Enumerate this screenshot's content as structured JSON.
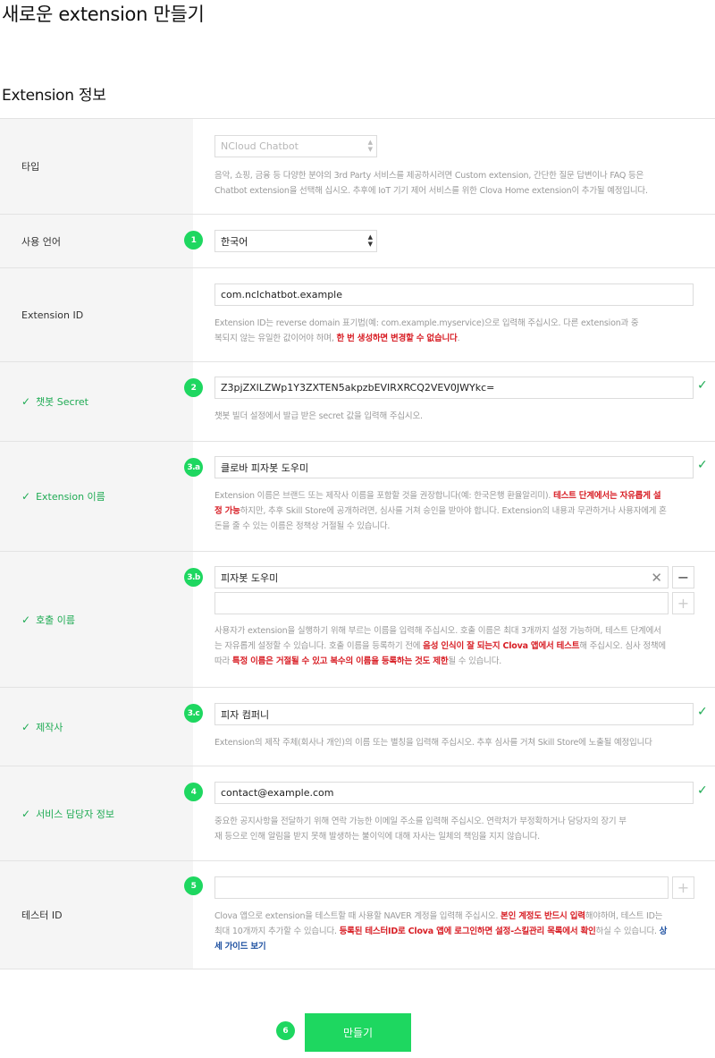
{
  "page": {
    "title": "새로운 extension 만들기",
    "section_title": "Extension 정보"
  },
  "colors": {
    "accent": "#1ed760",
    "valid": "#1fab54",
    "warning": "#d81f26",
    "link": "#1c4fa0"
  },
  "icons": {
    "check": "check-icon",
    "clear": "close-icon",
    "remove": "minus-icon",
    "add": "plus-icon",
    "select": "select-arrows-icon"
  },
  "rows": {
    "type": {
      "label": "타입",
      "value": "NCloud Chatbot",
      "help1": "음악, 쇼핑, 금융 등 다양한 분야의 3rd Party 서비스를 제공하시려면 Custom extension, 간단한 질문 답변이나 FAQ 등은",
      "help2": "Chatbot extension을 선택해 십시오. 추후에 IoT 기기 제어 서비스를 위한 Clova Home extension이 추가될 예정입니다."
    },
    "language": {
      "label": "사용 언어",
      "badge": "1",
      "value": "한국어"
    },
    "extension_id": {
      "label": "Extension ID",
      "value": "com.nclchatbot.example",
      "help1": "Extension ID는 reverse domain 표기법(예: com.example.myservice)으로 입력해 주십시오. 다른 extension과 중",
      "help2a": "복되지 않는 유일한 값이어야 하며, ",
      "help2b": "한 번 생성하면 변경할 수 없습니다",
      "help2c": "."
    },
    "secret": {
      "label": "챗봇 Secret",
      "badge": "2",
      "value": "Z3pjZXlLZWp1Y3ZXTEN5akpzbEVIRXRCQ2VEV0JWYkc=",
      "help": "챗봇 빌더 설정에서 발급 받은 secret 값을 입력해 주십시오."
    },
    "ext_name": {
      "label": "Extension 이름",
      "badge": "3.a",
      "value": "클로바 피자봇 도우미",
      "help1a": "Extension 이름은 브랜드 또는 제작사 이름을 포함할 것을 권장합니다(예: 한국은행 환율알리미). ",
      "help1b": "테스트 단계에서는 자유롭게 설",
      "help2a": "정 가능",
      "help2b": "하지만, 추후 Skill Store에 공개하려면, 심사를 거쳐 승인을 받아야 합니다. Extension의 내용과 무관하거나 사용자에게 혼",
      "help3": "돈을 줄 수 있는 이름은 정책상 거절될 수 있습니다."
    },
    "call_name": {
      "label": "호출 이름",
      "badge": "3.b",
      "value": "피자봇 도우미",
      "second_value": "",
      "remove_label": "−",
      "add_label": "+",
      "help1": "사용자가 extension을 실행하기 위해 부르는 이름을 입력해 주십시오. 호출 이름은 최대 3개까지 설정 가능하며, 테스트 단계에서",
      "help2a": "는 자유롭게 설정할 수 있습니다. 호출 이름을 등록하기 전에 ",
      "help2b": "음성 인식이 잘 되는지 Clova 앱에서 테스트",
      "help2c": "해 주십시오. 심사 정책에",
      "help3a": "따라 ",
      "help3b": "특정 이름은 거절될 수 있고 복수의 이름을 등록하는 것도 제한",
      "help3c": "될 수 있습니다."
    },
    "maker": {
      "label": "제작사",
      "badge": "3.c",
      "value": "피자 컴퍼니",
      "help": "Extension의 제작 주체(회사나 개인)의 이름 또는 별칭을 입력해 주십시오. 추후 심사를 거쳐 Skill Store에 노출될 예정입니다"
    },
    "contact": {
      "label": "서비스 담당자 정보",
      "badge": "4",
      "value": "contact@example.com",
      "help1": "중요한 공지사항을 전달하기 위해 연락 가능한 이메일 주소를 입력해 주십시오. 연락처가 부정확하거나 담당자의 장기 부",
      "help2": "재 등으로 인해 알림을 받지 못해 발생하는 불이익에 대해 자사는 일체의 책임을 지지 않습니다."
    },
    "tester": {
      "label": "테스터 ID",
      "badge": "5",
      "value": "",
      "add_label": "+",
      "help1a": "Clova 앱으로 extension을 테스트할 때 사용할 NAVER 계정을 입력해 주십시오. ",
      "help1b": "본인 계정도 반드시 입력",
      "help1c": "해야하며, 테스트 ID는",
      "help2a": "최대 10개까지 추가할 수 있습니다. ",
      "help2b": "등록된 테스터ID로 Clova 앱에 로그인하면 설정-스킬관리 목록에서 확인",
      "help2c": "하실 수 있습니다. ",
      "help2d": "상",
      "help3": "세 가이드 보기"
    }
  },
  "submit": {
    "badge": "6",
    "label": "만들기"
  }
}
